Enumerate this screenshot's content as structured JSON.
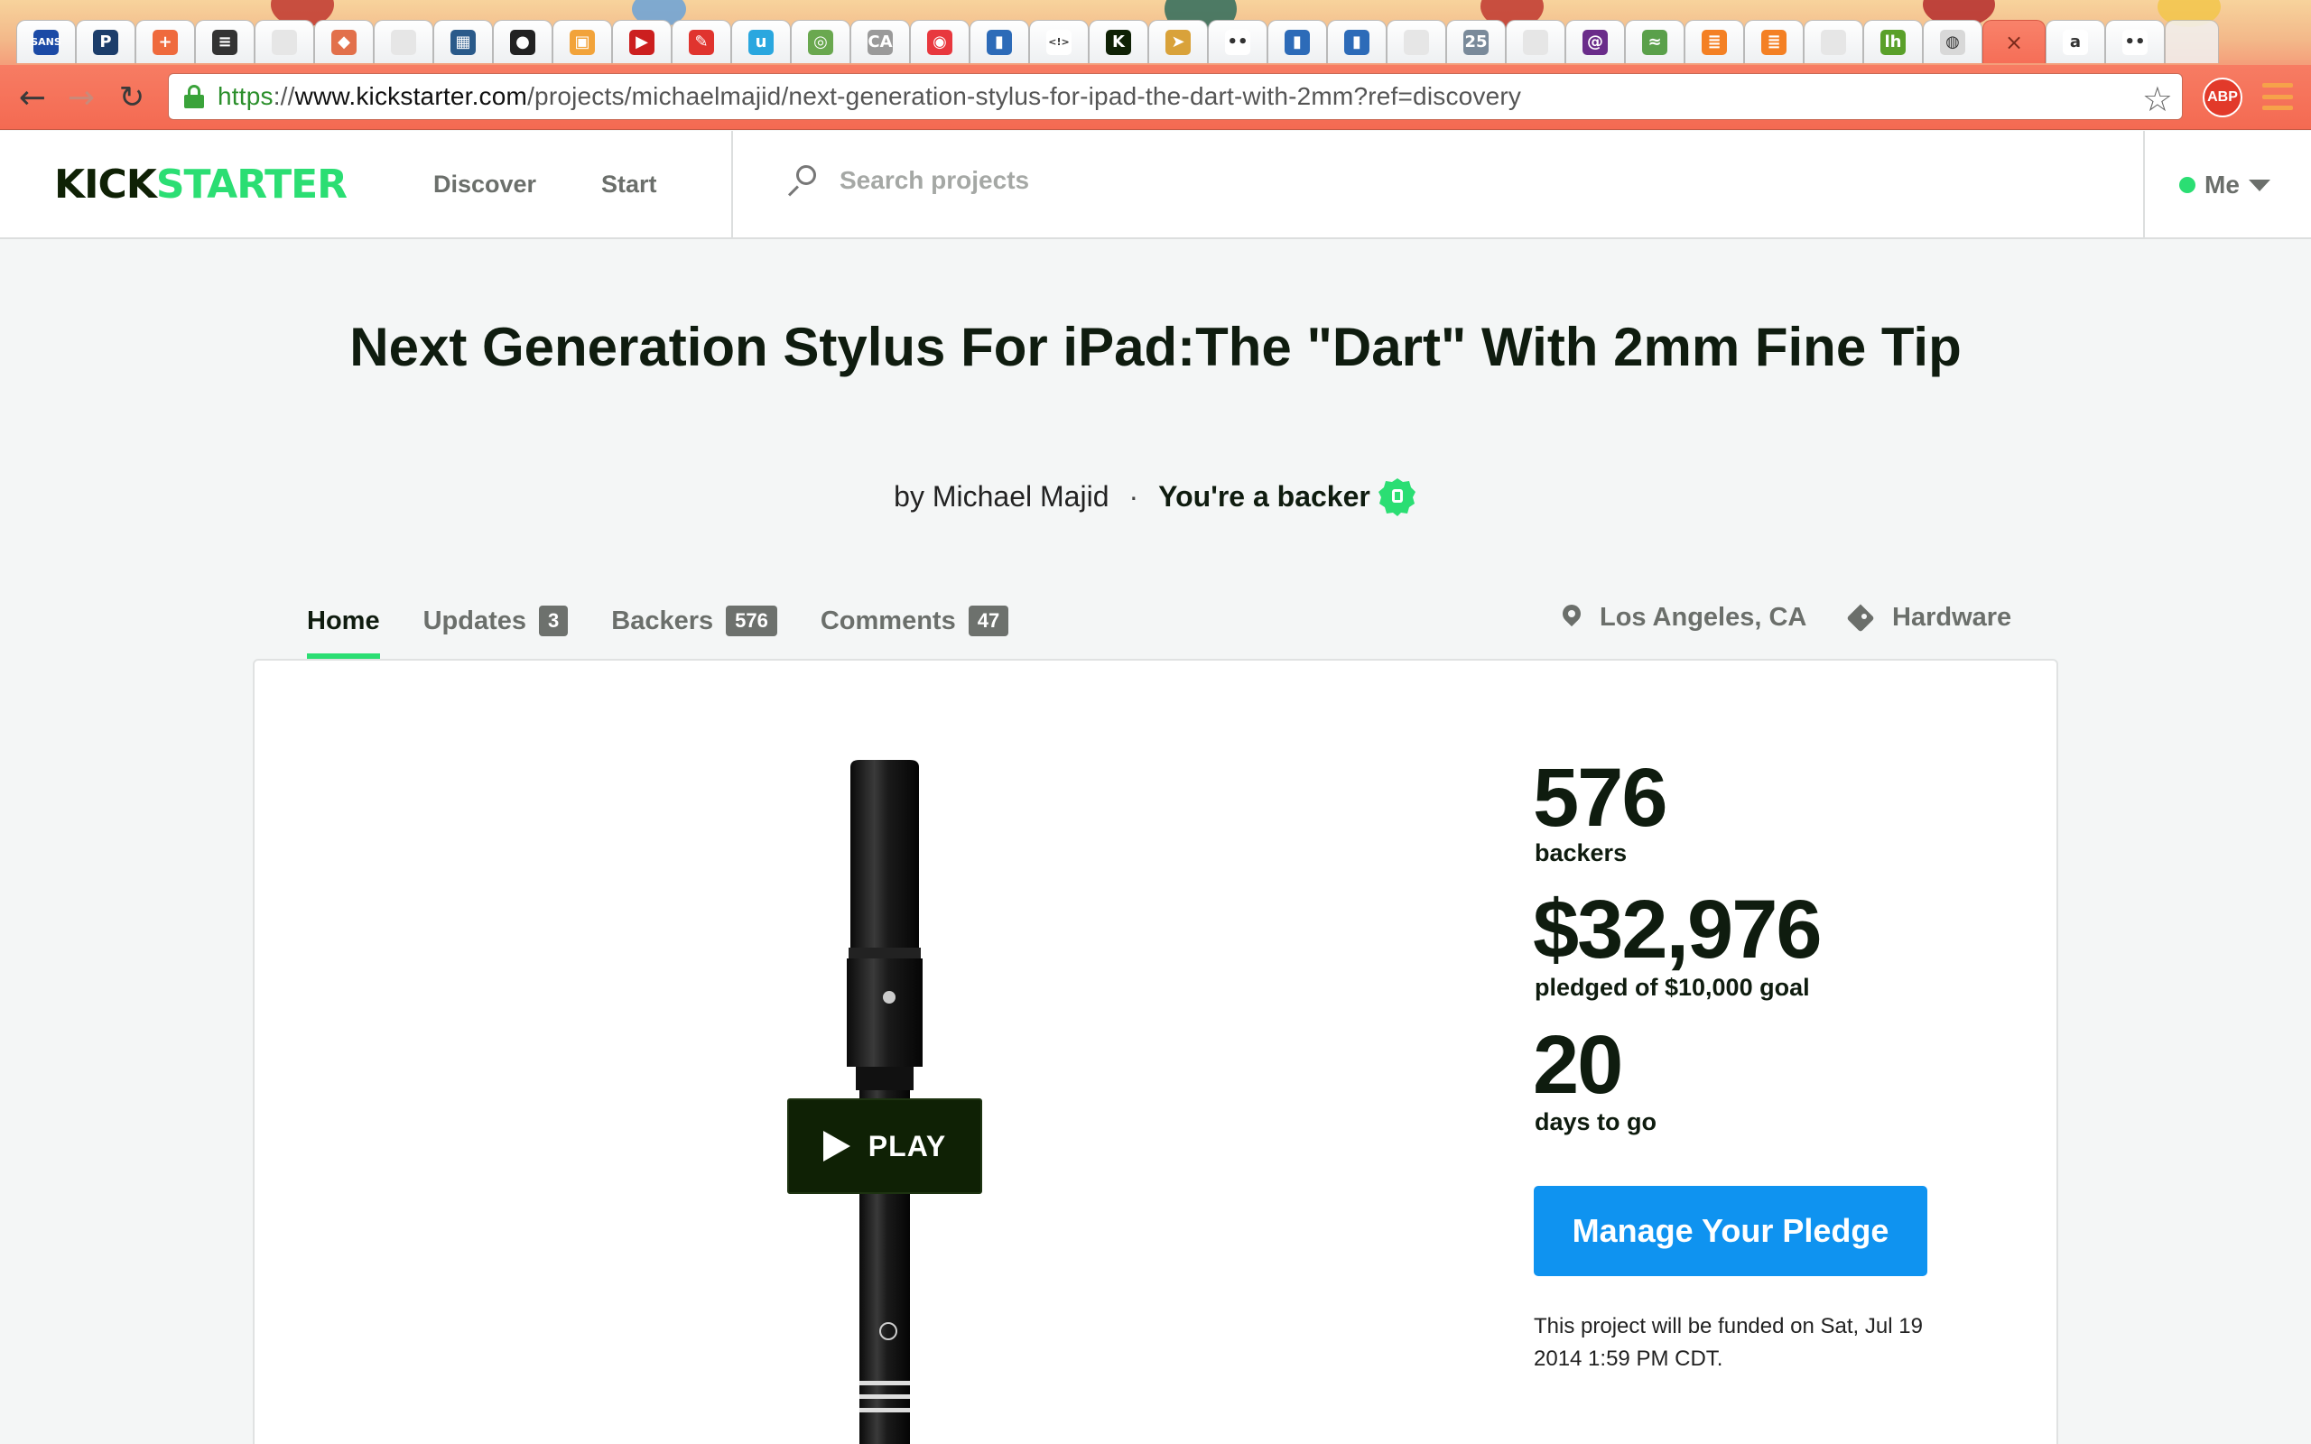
{
  "browser": {
    "url_scheme": "https",
    "url_separator": "://",
    "url_host": "www.kickstarter.com",
    "url_path": "/projects/michaelmajid/next-generation-stylus-for-ipad-the-dart-with-2mm?ref=discovery",
    "close_tab_glyph": "×",
    "extension_label": "ABP",
    "tab_favicons": [
      {
        "icon": "sans-icon",
        "glyph": "SANS",
        "bg": "#1b4aa6"
      },
      {
        "icon": "p-icon",
        "glyph": "P",
        "bg": "#1c3d6a"
      },
      {
        "icon": "plus-icon",
        "glyph": "+",
        "bg": "#ef6a3d"
      },
      {
        "icon": "stack-icon",
        "glyph": "≡",
        "bg": "#333333"
      },
      {
        "icon": "blank-page-icon",
        "glyph": "",
        "bg": "#e6e6e6"
      },
      {
        "icon": "bird-icon",
        "glyph": "◆",
        "bg": "#e2704b"
      },
      {
        "icon": "blank-page-icon",
        "glyph": "",
        "bg": "#e6e6e6"
      },
      {
        "icon": "grid-icon",
        "glyph": "▦",
        "bg": "#2a5a8a"
      },
      {
        "icon": "github-icon",
        "glyph": "●",
        "bg": "#222222"
      },
      {
        "icon": "tiles-icon",
        "glyph": "▣",
        "bg": "#f2a33a"
      },
      {
        "icon": "youtube-icon",
        "glyph": "▶",
        "bg": "#cc1f1f"
      },
      {
        "icon": "pen-icon",
        "glyph": "✎",
        "bg": "#e0342e"
      },
      {
        "icon": "u-icon",
        "glyph": "u",
        "bg": "#2aa7df"
      },
      {
        "icon": "swirl-icon",
        "glyph": "◎",
        "bg": "#6aa84f"
      },
      {
        "icon": "ca-icon",
        "glyph": "CA",
        "bg": "#9a9a9a"
      },
      {
        "icon": "target-icon",
        "glyph": "◉",
        "bg": "#e8383e"
      },
      {
        "icon": "book-icon",
        "glyph": "▮",
        "bg": "#2d6bb8"
      },
      {
        "icon": "code-icon",
        "glyph": "<!>",
        "bg": "#ffffff"
      },
      {
        "icon": "kickstarter-icon",
        "glyph": "K",
        "bg": "#0f2105"
      },
      {
        "icon": "arrow-icon",
        "glyph": "➤",
        "bg": "#d9a23a"
      },
      {
        "icon": "flickr-icon",
        "glyph": "••",
        "bg": "#ffffff"
      },
      {
        "icon": "book-icon",
        "glyph": "▮",
        "bg": "#2d6bb8"
      },
      {
        "icon": "book-icon",
        "glyph": "▮",
        "bg": "#2d6bb8"
      },
      {
        "icon": "blank-page-icon",
        "glyph": "",
        "bg": "#e6e6e6"
      },
      {
        "icon": "calendar-icon",
        "glyph": "25",
        "bg": "#7a8a9a"
      },
      {
        "icon": "blank-page-icon",
        "glyph": "",
        "bg": "#e6e6e6"
      },
      {
        "icon": "spiral-icon",
        "glyph": "@",
        "bg": "#6a2c8a"
      },
      {
        "icon": "chart-icon",
        "glyph": "≈",
        "bg": "#5aa04a"
      },
      {
        "icon": "stackoverflow-icon",
        "glyph": "≣",
        "bg": "#f48024"
      },
      {
        "icon": "stackoverflow-icon",
        "glyph": "≣",
        "bg": "#f48024"
      },
      {
        "icon": "blank-page-icon",
        "glyph": "",
        "bg": "#e6e6e6"
      },
      {
        "icon": "lh-icon",
        "glyph": "lh",
        "bg": "#5aa02a"
      },
      {
        "icon": "chrome-icon",
        "glyph": "◍",
        "bg": "#d8d8d8"
      },
      {
        "icon": "close-tab-icon",
        "glyph": "×",
        "bg": "transparent",
        "active": true
      },
      {
        "icon": "amazon-icon",
        "glyph": "a",
        "bg": "#ffffff"
      },
      {
        "icon": "flickr-icon",
        "glyph": "••",
        "bg": "#ffffff"
      }
    ]
  },
  "site": {
    "logo_part1": "KICK",
    "logo_part2": "STARTER",
    "nav": {
      "discover": "Discover",
      "start": "Start"
    },
    "search_placeholder": "Search projects",
    "me_label": "Me",
    "brand_green": "#2bde73",
    "button_blue": "#0f93f0"
  },
  "project": {
    "title": "Next Generation Stylus For iPad:The \"Dart\" With 2mm Fine Tip",
    "by": "by Michael Majid",
    "separator": "·",
    "backer_status": "You're a backer",
    "tabs": [
      {
        "label": "Home",
        "count": null,
        "active": true
      },
      {
        "label": "Updates",
        "count": "3"
      },
      {
        "label": "Backers",
        "count": "576"
      },
      {
        "label": "Comments",
        "count": "47"
      }
    ],
    "location": "Los Angeles, CA",
    "category": "Hardware",
    "video_play_label": "PLAY",
    "stats": {
      "backers": "576",
      "backers_label": "backers",
      "pledged": "$32,976",
      "pledged_label": "pledged of $10,000 goal",
      "days": "20",
      "days_label": "days to go"
    },
    "manage_pledge_label": "Manage Your Pledge",
    "funding_note": "This project will be funded on Sat, Jul 19 2014 1:59 PM CDT."
  }
}
